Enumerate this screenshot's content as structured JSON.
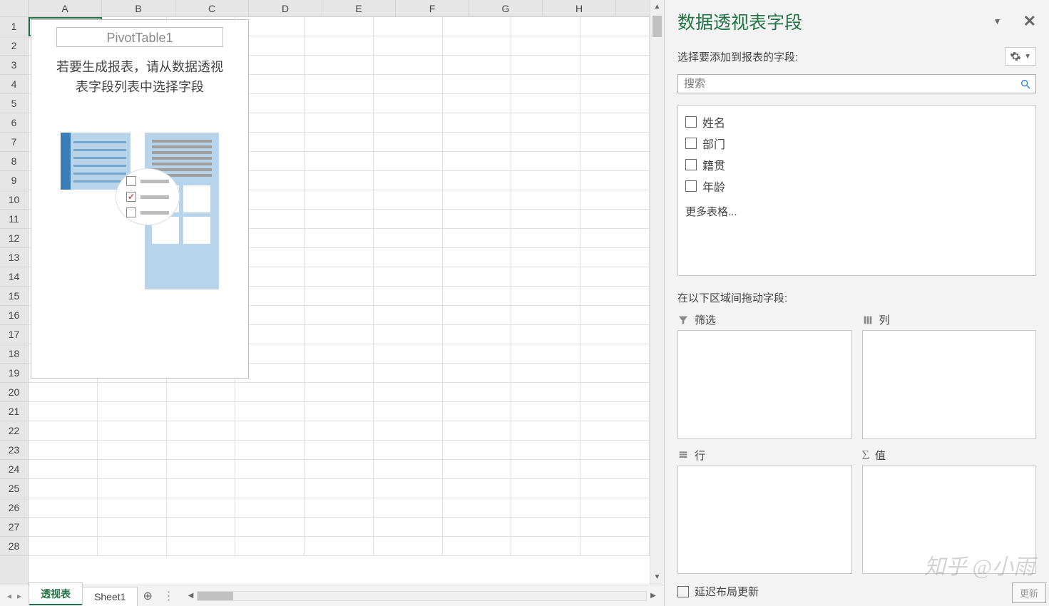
{
  "grid": {
    "columns": [
      "A",
      "B",
      "C",
      "D",
      "E",
      "F",
      "G",
      "H"
    ],
    "rows": [
      1,
      2,
      3,
      4,
      5,
      6,
      7,
      8,
      9,
      10,
      11,
      12,
      13,
      14,
      15,
      16,
      17,
      18,
      19,
      20,
      21,
      22,
      23,
      24,
      25,
      26,
      27,
      28
    ],
    "selected_cell": "A1"
  },
  "pivot_placeholder": {
    "title": "PivotTable1",
    "message_line1": "若要生成报表，请从数据透视",
    "message_line2": "表字段列表中选择字段"
  },
  "sheets": {
    "nav_first": "◂",
    "nav_prev": "▸",
    "tabs": [
      {
        "label": "透视表",
        "active": true
      },
      {
        "label": "Sheet1",
        "active": false
      }
    ],
    "add_label": "⊕"
  },
  "field_pane": {
    "title": "数据透视表字段",
    "subtitle": "选择要添加到报表的字段:",
    "search_placeholder": "搜索",
    "fields": [
      {
        "label": "姓名"
      },
      {
        "label": "部门"
      },
      {
        "label": "籍贯"
      },
      {
        "label": "年龄"
      }
    ],
    "more_tables": "更多表格...",
    "drag_label": "在以下区域间拖动字段:",
    "areas": {
      "filter": "筛选",
      "columns": "列",
      "rows": "行",
      "values": "值"
    },
    "defer_label": "延迟布局更新",
    "update_button": "更新"
  },
  "watermark": "知乎 @小雨"
}
